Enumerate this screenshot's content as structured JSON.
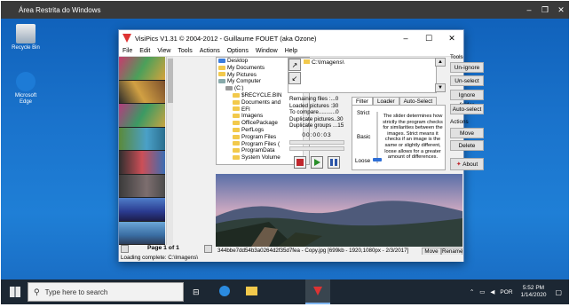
{
  "remote_bar": {
    "title": "Área Restrita do Windows"
  },
  "desktop": {
    "icons": [
      {
        "label": "Recycle Bin"
      },
      {
        "label": "Microsoft Edge"
      }
    ]
  },
  "window": {
    "title": "VisiPics V1.31 © 2004-2012 - Guillaume FOUET (aka Ozone)",
    "menu": [
      "File",
      "Edit",
      "View",
      "Tools",
      "Actions",
      "Options",
      "Window",
      "Help"
    ],
    "tree": [
      {
        "label": "Desktop",
        "level": 0
      },
      {
        "label": "My Documents",
        "level": 0
      },
      {
        "label": "My Pictures",
        "level": 0
      },
      {
        "label": "My Computer",
        "level": 0
      },
      {
        "label": "(C:)",
        "level": 1
      },
      {
        "label": "$RECYCLE.BIN",
        "level": 2
      },
      {
        "label": "Documents and",
        "level": 2
      },
      {
        "label": "EFI",
        "level": 2
      },
      {
        "label": "Imagens",
        "level": 2
      },
      {
        "label": "OfficePackage",
        "level": 2
      },
      {
        "label": "PerfLogs",
        "level": 2
      },
      {
        "label": "Program Files",
        "level": 2
      },
      {
        "label": "Program Files (",
        "level": 2
      },
      {
        "label": "ProgramData",
        "level": 2
      },
      {
        "label": "System Volume",
        "level": 2
      }
    ],
    "path": "C:\\Imagens\\",
    "stats": {
      "remaining": "Remaining files :...0",
      "loaded": "Loaded pictures :30",
      "compare": "To compare...........0",
      "duplicates": "Duplicate pictures..30",
      "groups": "Duplicate groups ...15",
      "timer": "00:00:03"
    },
    "tabs": [
      "Filter",
      "Loader",
      "Auto-Select"
    ],
    "filter_levels": [
      "Strict",
      "Basic",
      "Loose"
    ],
    "filter_description": "The slider determines how strictly the program checks for similarities between the images. Strict means it checks if an image is the same or slightly different, loose allows for a greater amount of differences.",
    "tools_title": "Tools",
    "tools_buttons": [
      "Un-ignore",
      "Un-select",
      "Ignore folder",
      "Auto-select"
    ],
    "actions_title": "Actions",
    "actions_buttons": [
      "Move",
      "Delete"
    ],
    "about_label": "About",
    "page_label": "Page 1 of 1",
    "preview_info": "344bbe7dd54b3a0264d2f35d7fea - Copy.jpg [699kb - 1920,1080px - 2/3/2017]",
    "preview_move": "Move",
    "preview_rename": "Rename",
    "status": "Loading complete: C:\\Imagens\\"
  },
  "taskbar": {
    "search_placeholder": "Type here to search",
    "lang": "POR",
    "time": "5:52 PM",
    "date": "1/14/2020"
  }
}
